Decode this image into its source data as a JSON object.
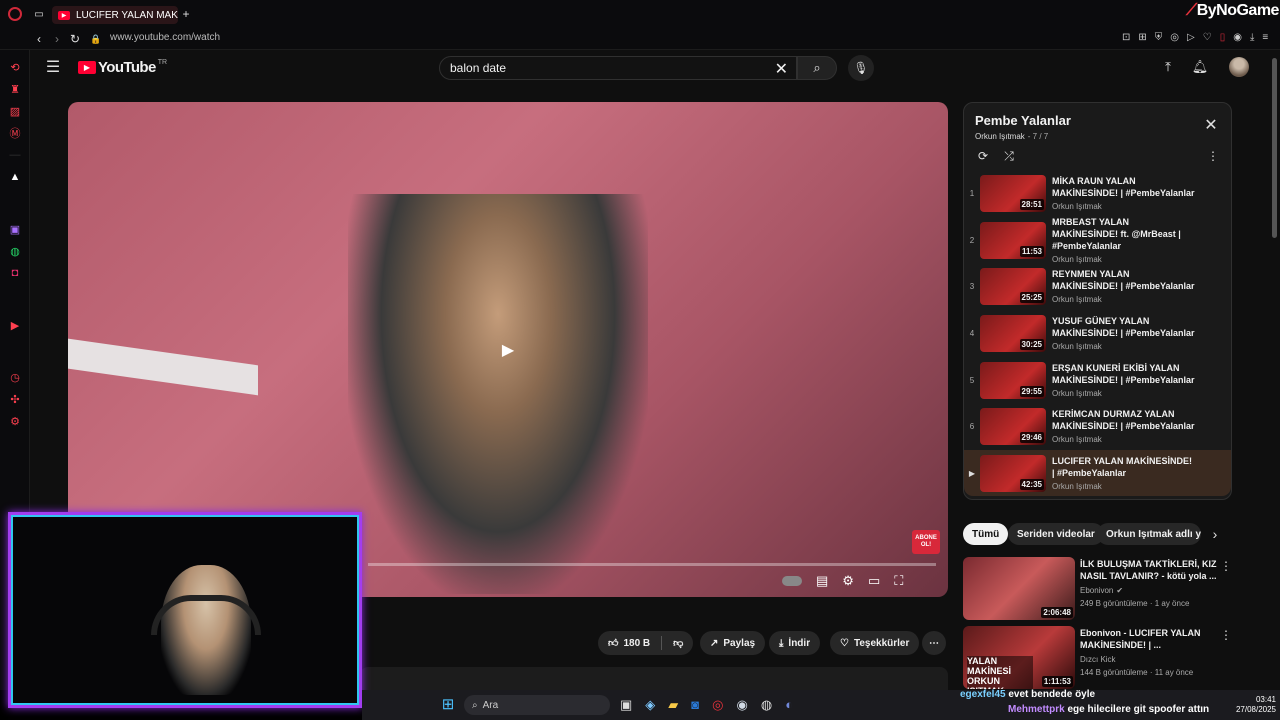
{
  "browser": {
    "tab_title": "LUCIFER YALAN MAKİNESİ",
    "url": "www.youtube.com/watch",
    "watermark": "ByNoGame"
  },
  "youtube": {
    "logo_text": "YouTube",
    "region": "TR",
    "search_value": "balon date"
  },
  "playlist": {
    "title": "Pembe Yalanlar",
    "channel": "Orkun Işıtmak",
    "position": "- 7 / 7",
    "items": [
      {
        "index": "1",
        "title": "MİKA RAUN YALAN MAKİNESİNDE! | #PembeYalanlar",
        "channel": "Orkun Işıtmak",
        "duration": "28:51"
      },
      {
        "index": "2",
        "title": "MRBEAST YALAN MAKİNESİNDE! ft. @MrBeast | #PembeYalanlar",
        "channel": "Orkun Işıtmak",
        "duration": "11:53"
      },
      {
        "index": "3",
        "title": "REYNMEN YALAN MAKİNESİNDE! | #PembeYalanlar",
        "channel": "Orkun Işıtmak",
        "duration": "25:25"
      },
      {
        "index": "4",
        "title": "YUSUF GÜNEY YALAN MAKİNESİNDE! | #PembeYalanlar",
        "channel": "Orkun Işıtmak",
        "duration": "30:25"
      },
      {
        "index": "5",
        "title": "ERŞAN KUNERİ EKİBİ YALAN MAKİNESİNDE! | #PembeYalanlar",
        "channel": "Orkun Işıtmak",
        "duration": "29:55"
      },
      {
        "index": "6",
        "title": "KERİMCAN DURMAZ YALAN MAKİNESİNDE! | #PembeYalanlar",
        "channel": "Orkun Işıtmak",
        "duration": "29:46"
      },
      {
        "index": "▶",
        "title": "LUCIFER YALAN MAKİNESİNDE! | #PembeYalanlar",
        "channel": "Orkun Işıtmak",
        "duration": "42:35"
      }
    ]
  },
  "chips": [
    "Tümü",
    "Seriden videolar",
    "Orkun Işıtmak adlı yü"
  ],
  "recommendations": [
    {
      "title": "İLK BULUŞMA TAKTİKLERİ, KIZ NASIL TAVLANIR? - kötü yola ...",
      "channel": "Ebonivon",
      "meta": "249 B görüntüleme · 1 ay önce",
      "duration": "2:06:48"
    },
    {
      "title": "Ebonivon - LUCIFER YALAN MAKİNESİNDE! | ...",
      "channel": "Dızcı Kick",
      "meta": "144 B görüntüleme · 11 ay önce",
      "duration": "1:11:53",
      "thumb_text": "YALAN MAKİNESİ ORKUN IŞITMAK"
    }
  ],
  "actions": {
    "like_count": "180 B",
    "share": "Paylaş",
    "download": "İndir",
    "thanks": "Teşekkürler"
  },
  "player": {
    "subscribe_badge": "ABONE OL!"
  },
  "chat": [
    {
      "user": "egexfel45",
      "message": "evet bendede öyle"
    },
    {
      "user": "Mehmettprk",
      "message": "ege hilecilere git spoofer attın"
    }
  ],
  "taskbar": {
    "search_placeholder": "Ara",
    "time": "03:41",
    "date": "27/08/2025"
  },
  "colors": {
    "yt_red": "#ff0033",
    "webcam_frame": "#a23df0",
    "webcam_glow": "#31c6f0"
  }
}
